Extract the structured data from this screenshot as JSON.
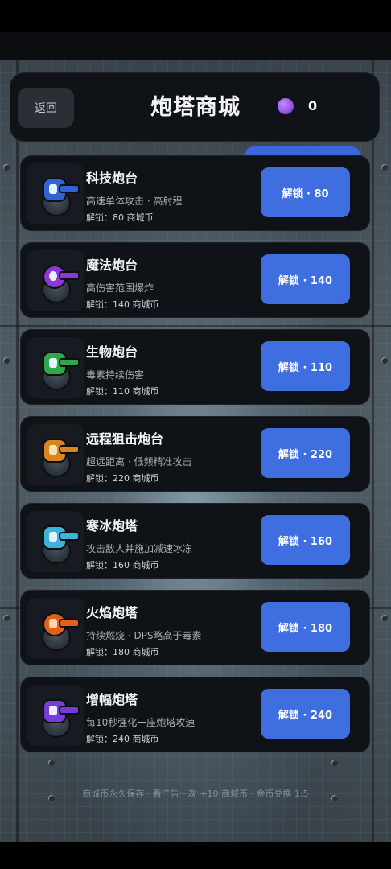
{
  "header": {
    "back_label": "返回",
    "title": "炮塔商城",
    "coin_count": "0",
    "coin_color": "#9553e6"
  },
  "turrets": [
    {
      "name": "科技炮台",
      "desc": "高速单体攻击 · 高射程",
      "cost": "解锁：80 商城币",
      "button": "解锁 · 80",
      "color": "#2f63d6",
      "icon": "tech-turret-icon"
    },
    {
      "name": "魔法炮台",
      "desc": "高伤害范围爆炸",
      "cost": "解锁：140 商城币",
      "button": "解锁 · 140",
      "color": "#8a38d8",
      "icon": "magic-turret-icon"
    },
    {
      "name": "生物炮台",
      "desc": "毒素持续伤害",
      "cost": "解锁：110 商城币",
      "button": "解锁 · 110",
      "color": "#2fa84a",
      "icon": "bio-turret-icon"
    },
    {
      "name": "远程狙击炮台",
      "desc": "超远距离 · 低频精准攻击",
      "cost": "解锁：220 商城币",
      "button": "解锁 · 220",
      "color": "#d9861f",
      "icon": "sniper-turret-icon"
    },
    {
      "name": "寒冰炮塔",
      "desc": "攻击敌人并施加减速冰冻",
      "cost": "解锁：160 商城币",
      "button": "解锁 · 160",
      "color": "#3ab4d8",
      "icon": "ice-turret-icon"
    },
    {
      "name": "火焰炮塔",
      "desc": "持续燃烧 · DPS略高于毒素",
      "cost": "解锁：180 商城币",
      "button": "解锁 · 180",
      "color": "#e0601c",
      "icon": "fire-turret-icon"
    },
    {
      "name": "增幅炮塔",
      "desc": "每10秒强化一座炮塔攻速",
      "cost": "解锁：240 商城币",
      "button": "解锁 · 240",
      "color": "#7a3ad8",
      "icon": "amplify-turret-icon"
    }
  ],
  "footer": {
    "note": "商城币永久保存 · 看广告一次 +10 商城币 · 金币兑换 1:5"
  }
}
